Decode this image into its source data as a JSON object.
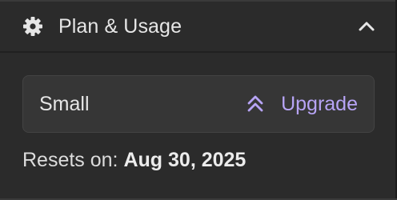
{
  "header": {
    "title": "Plan & Usage",
    "icon": "gear-icon",
    "toggle_icon": "chevron-up-icon"
  },
  "plan": {
    "name": "Small",
    "upgrade_label": "Upgrade",
    "upgrade_icon": "double-chevron-up-icon"
  },
  "usage": {
    "resets_label": "Resets on:",
    "resets_date": "Aug 30, 2025"
  },
  "colors": {
    "background": "#2b2b2b",
    "card": "#363636",
    "accent": "#b7a4f5",
    "text": "#e6e6e6"
  }
}
